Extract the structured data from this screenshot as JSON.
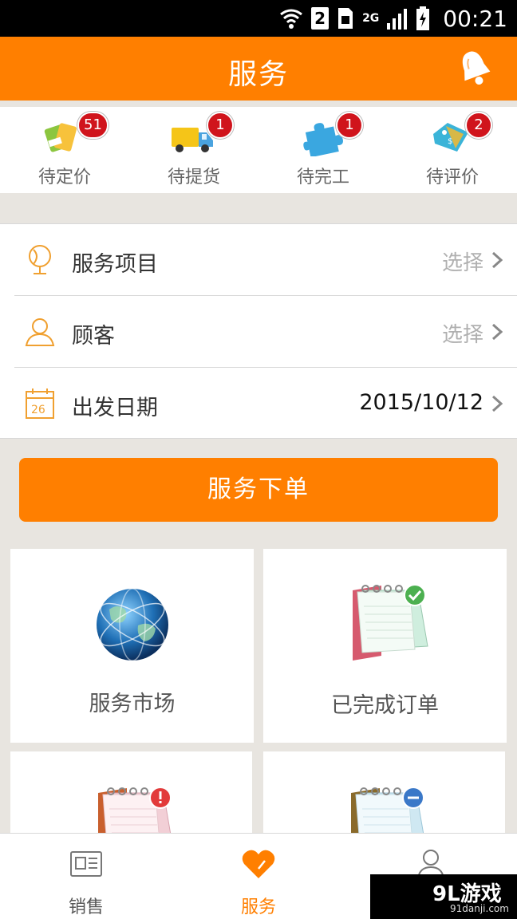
{
  "status_bar": {
    "sim": "2",
    "network": "2G",
    "time": "00:21"
  },
  "header": {
    "title": "服务",
    "bell_icon": "bell-icon"
  },
  "status_items": [
    {
      "label": "待定价",
      "count": "51",
      "icon": "tag-icon"
    },
    {
      "label": "待提货",
      "count": "1",
      "icon": "truck-icon"
    },
    {
      "label": "待完工",
      "count": "1",
      "icon": "puzzle-icon"
    },
    {
      "label": "待评价",
      "count": "2",
      "icon": "price-tag-icon"
    }
  ],
  "form": {
    "service_item": {
      "label": "服务项目",
      "value": "选择"
    },
    "customer": {
      "label": "顾客",
      "value": "选择"
    },
    "departure_date": {
      "label": "出发日期",
      "value": "2015/10/12",
      "calendar_day": "26"
    }
  },
  "order_button": "服务下单",
  "tiles": [
    {
      "label": "服务市场",
      "icon": "globe-icon"
    },
    {
      "label": "已完成订单",
      "icon": "notebook-check-icon"
    },
    {
      "label": "",
      "icon": "notebook-alert-icon"
    },
    {
      "label": "",
      "icon": "notebook-minus-icon"
    }
  ],
  "bottom_nav": [
    {
      "label": "销售",
      "icon": "id-card-icon",
      "active": false
    },
    {
      "label": "服务",
      "icon": "heart-icon",
      "active": true
    },
    {
      "label": "",
      "icon": "user-icon",
      "active": false
    }
  ],
  "watermark": {
    "brand": "9L游戏",
    "url": "91danji.com"
  },
  "colors": {
    "accent": "#ff7f00",
    "badge": "#d0141c",
    "background": "#e8e5e0"
  }
}
